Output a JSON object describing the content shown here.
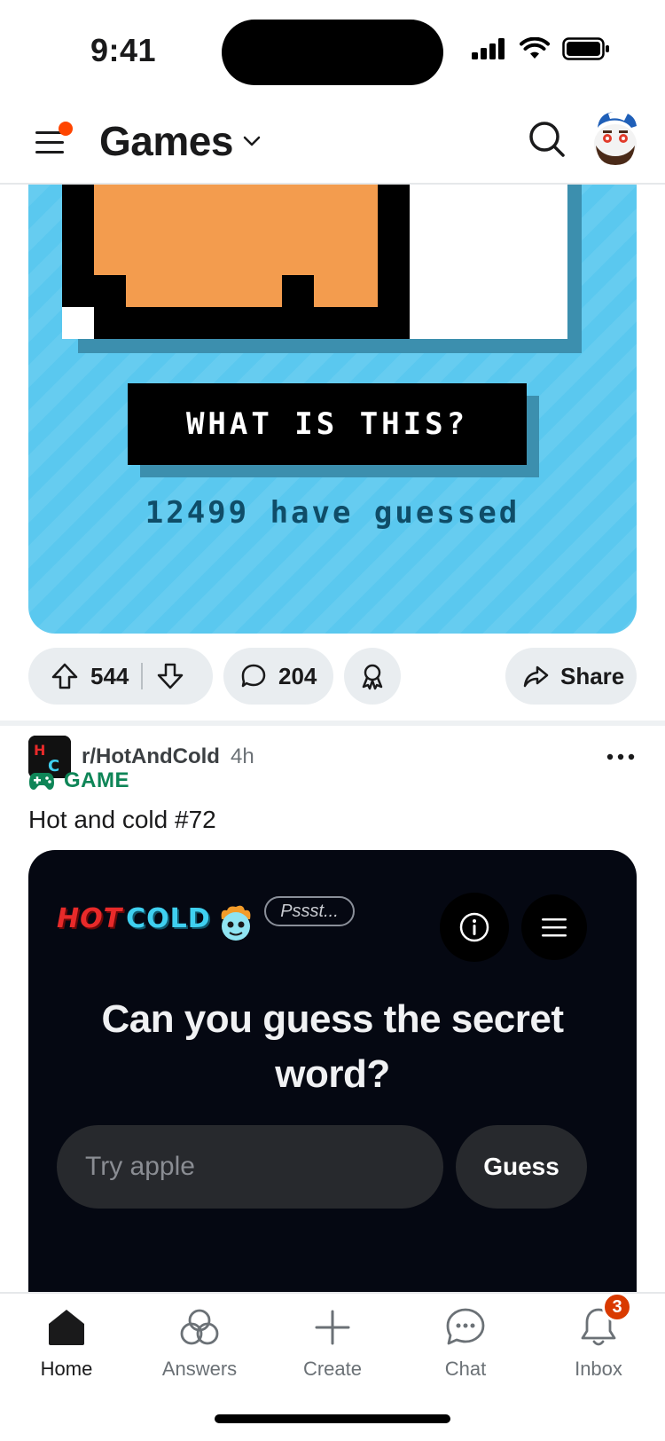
{
  "status_bar": {
    "time": "9:41"
  },
  "header": {
    "title": "Games"
  },
  "game_card": {
    "prompt": "WHAT IS THIS?",
    "guessed_text": "12499 have guessed"
  },
  "post_actions": {
    "upvotes": "544",
    "comments": "204",
    "share_label": "Share"
  },
  "post": {
    "subreddit": "r/HotAndCold",
    "age": "4h",
    "flair": "GAME",
    "title": "Hot and cold #72"
  },
  "hot_cold": {
    "logo_hot": "HOT",
    "logo_cold": "COLD",
    "bubble": "Pssst...",
    "question": "Can you guess the secret word?",
    "input_placeholder": "Try apple",
    "guess_label": "Guess"
  },
  "bottom_nav": {
    "items": [
      {
        "label": "Home",
        "icon": "home-icon"
      },
      {
        "label": "Answers",
        "icon": "answers-icon"
      },
      {
        "label": "Create",
        "icon": "plus-icon"
      },
      {
        "label": "Chat",
        "icon": "chat-icon"
      },
      {
        "label": "Inbox",
        "icon": "bell-icon"
      }
    ],
    "inbox_badge": "3"
  },
  "colors": {
    "accent": "#ff4500",
    "flair_green": "#0e8557",
    "game_bg": "#5ac8ef",
    "hc_bg": "#050812"
  }
}
